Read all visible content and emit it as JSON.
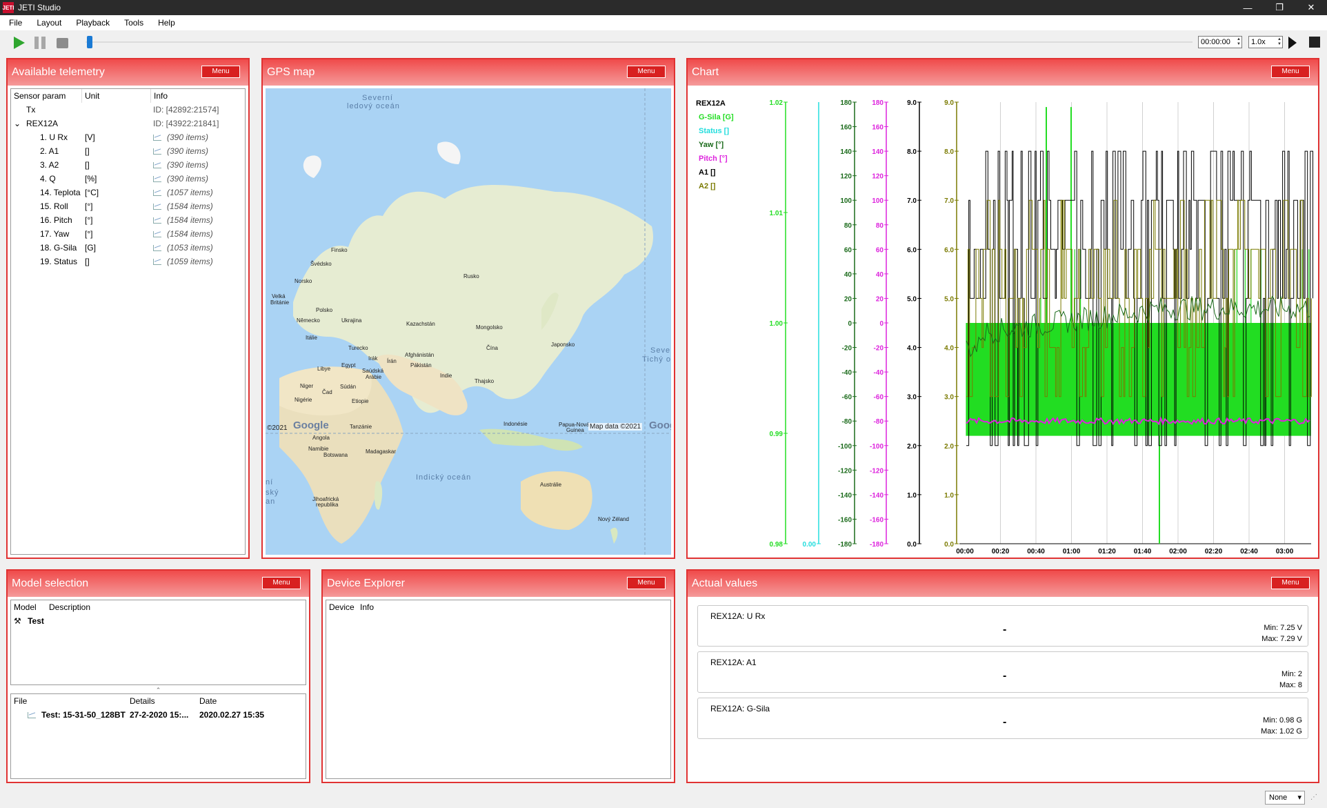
{
  "window": {
    "title": "JETI Studio",
    "logo": "JETI",
    "controls": [
      "—",
      "❐",
      "✕"
    ]
  },
  "menu": [
    "File",
    "Layout",
    "Playback",
    "Tools",
    "Help"
  ],
  "toolbar": {
    "time": "00:00:00",
    "speed": "1.0x"
  },
  "telemetry": {
    "title": "Available telemetry",
    "menu": "Menu",
    "headers": [
      "Sensor param",
      "Unit",
      "Info"
    ],
    "rows": [
      {
        "name": "Tx",
        "unit": "",
        "info": "ID: [42892:21574]",
        "indent": 1,
        "kind": "id"
      },
      {
        "name": "REX12A",
        "unit": "",
        "info": "ID: [43922:21841]",
        "indent": 1,
        "kind": "id",
        "expand": "⌄"
      },
      {
        "name": "1. U Rx",
        "unit": "[V]",
        "info": "(390 items)",
        "indent": 2
      },
      {
        "name": "2. A1",
        "unit": "[]",
        "info": "(390 items)",
        "indent": 2
      },
      {
        "name": "3. A2",
        "unit": "[]",
        "info": "(390 items)",
        "indent": 2
      },
      {
        "name": "4. Q",
        "unit": "[%]",
        "info": "(390 items)",
        "indent": 2
      },
      {
        "name": "14. Teplota",
        "unit": "[°C]",
        "info": "(1057 items)",
        "indent": 2
      },
      {
        "name": "15. Roll",
        "unit": "[°]",
        "info": "(1584 items)",
        "indent": 2
      },
      {
        "name": "16. Pitch",
        "unit": "[°]",
        "info": "(1584 items)",
        "indent": 2
      },
      {
        "name": "17. Yaw",
        "unit": "[°]",
        "info": "(1584 items)",
        "indent": 2
      },
      {
        "name": "18. G-Sila",
        "unit": "[G]",
        "info": "(1053 items)",
        "indent": 2
      },
      {
        "name": "19. Status",
        "unit": "[]",
        "info": "(1059 items)",
        "indent": 2
      }
    ]
  },
  "gps": {
    "title": "GPS map",
    "menu": "Menu",
    "labels": {
      "severni": "Severní",
      "ledovy": "ledový oceán",
      "finsko": "Finsko",
      "svedsko": "Švédsko",
      "norsko": "Norsko",
      "rusko": "Rusko",
      "velka": "Velká",
      "britanie": "Británie",
      "polsko": "Polsko",
      "nemecko": "Německo",
      "ukrajina": "Ukrajina",
      "kazachstan": "Kazachstán",
      "mongolsko": "Mongolsko",
      "italie": "Itálie",
      "turecko": "Turecko",
      "cina": "Čína",
      "japonsko": "Japonsko",
      "afghanistan": "Afghánistán",
      "irak": "Irák",
      "iran": "Írán",
      "pakistan": "Pákistán",
      "libye": "Libye",
      "egypt": "Egypt",
      "saudska": "Saúdská",
      "arabie": "Arábie",
      "indie": "Indie",
      "thajsko": "Thajsko",
      "niger": "Niger",
      "cad": "Čad",
      "sudan": "Súdán",
      "nigerie": "Nigérie",
      "etiopie": "Etiopie",
      "indonesie": "Indonésie",
      "papua": "Papua-Nová",
      "guinea": "Guinea",
      "tanzanie": "Tanzánie",
      "angola": "Angola",
      "namibie": "Namibie",
      "botswana": "Botswana",
      "madagaskar": "Madagaskar",
      "australie": "Austrálie",
      "jihoafricka": "Jihoafrická",
      "republika": "republika",
      "novy_zeland": "Nový Zéland",
      "indicky": "Indický oceán",
      "seve": "Seve",
      "tichy": "Tichý o",
      "ni": "ní",
      "sky": "ský",
      "an": "an"
    },
    "copyright": "©2021",
    "google": "Google",
    "google2": "Goog",
    "attribution": "Map data ©2021"
  },
  "chart": {
    "title": "Chart",
    "menu": "Menu",
    "legend": {
      "device": "REX12A",
      "items": [
        {
          "label": "G-Sila [G]",
          "color": "#22dd22"
        },
        {
          "label": "Status []",
          "color": "#22dddd"
        },
        {
          "label": "Yaw [°]",
          "color": "#1a6a1a"
        },
        {
          "label": "Pitch [°]",
          "color": "#dd22dd"
        },
        {
          "label": "A1 []",
          "color": "#000000"
        },
        {
          "label": "A2 []",
          "color": "#7a7a00"
        }
      ]
    },
    "chart_data": {
      "type": "line",
      "x_ticks": [
        "00:00",
        "00:20",
        "00:40",
        "01:00",
        "01:20",
        "01:40",
        "02:00",
        "02:20",
        "02:40",
        "03:00",
        "03:"
      ],
      "axes": [
        {
          "name": "G-Sila",
          "color": "#22dd22",
          "ticks": [
            "1.02",
            "1.01",
            "1.00",
            "0.99",
            "0.98"
          ],
          "range": [
            0.98,
            1.02
          ]
        },
        {
          "name": "Status",
          "color": "#22dddd",
          "ticks": [
            "0.00"
          ],
          "range": [
            0,
            1
          ]
        },
        {
          "name": "Yaw",
          "color": "#1a6a1a",
          "ticks": [
            "180",
            "160",
            "140",
            "120",
            "100",
            "80",
            "60",
            "40",
            "20",
            "0",
            "-20",
            "-40",
            "-60",
            "-80",
            "-100",
            "-120",
            "-140",
            "-160",
            "-180"
          ],
          "range": [
            -180,
            180
          ]
        },
        {
          "name": "Pitch",
          "color": "#dd22dd",
          "ticks": [
            "180",
            "160",
            "140",
            "120",
            "100",
            "80",
            "60",
            "40",
            "20",
            "0",
            "-20",
            "-40",
            "-60",
            "-80",
            "-100",
            "-120",
            "-140",
            "-160",
            "-180"
          ],
          "range": [
            -180,
            180
          ]
        },
        {
          "name": "A1",
          "color": "#000000",
          "ticks": [
            "9.0",
            "8.0",
            "7.0",
            "6.0",
            "5.0",
            "4.0",
            "3.0",
            "2.0",
            "1.0",
            "0.0"
          ],
          "range": [
            0,
            9
          ]
        },
        {
          "name": "A2",
          "color": "#7a7a00",
          "ticks": [
            "9.0",
            "8.0",
            "7.0",
            "6.0",
            "5.0",
            "4.0",
            "3.0",
            "2.0",
            "1.0",
            "0.0"
          ],
          "range": [
            0,
            9
          ]
        }
      ]
    }
  },
  "model": {
    "title": "Model selection",
    "menu": "Menu",
    "headers": [
      "Model",
      "Description"
    ],
    "model_name": "Test",
    "file_headers": [
      "File",
      "Details",
      "Date"
    ],
    "file_row": {
      "file": "Test: 15-31-50_128BT",
      "details": "27-2-2020 15:...",
      "date": "2020.02.27 15:35"
    }
  },
  "device": {
    "title": "Device Explorer",
    "menu": "Menu",
    "headers": [
      "Device",
      "Info"
    ]
  },
  "actual": {
    "title": "Actual values",
    "menu": "Menu",
    "cards": [
      {
        "name": "REX12A: U Rx",
        "value": "-",
        "min": "Min: 7.25 V",
        "max": "Max: 7.29 V"
      },
      {
        "name": "REX12A: A1",
        "value": "-",
        "min": "Min: 2",
        "max": "Max: 8"
      },
      {
        "name": "REX12A: G-Sila",
        "value": "-",
        "min": "Min: 0.98 G",
        "max": "Max: 1.02 G"
      }
    ]
  },
  "status": {
    "select": "None"
  }
}
